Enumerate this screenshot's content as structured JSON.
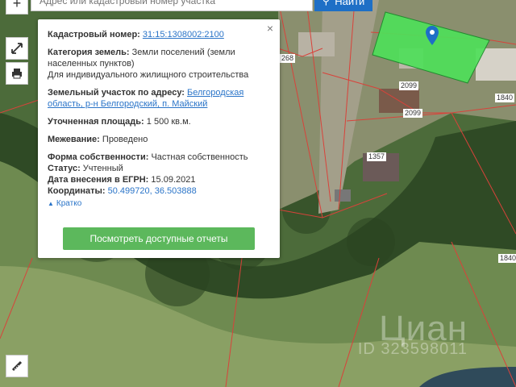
{
  "search": {
    "placeholder": "Адрес или кадастровый номер участка",
    "button_label": "Найти"
  },
  "popup": {
    "cadastral_label": "Кадастровый номер:",
    "cadastral_value": "31:15:1308002:2100",
    "category_label": "Категория земель:",
    "category_value": "Земли поселений (земли населенных пунктов)",
    "purpose": "Для индивидуального жилищного строительства",
    "address_label": "Земельный участок по адресу:",
    "address_value": "Белгородская область, р-н Белгородский, п. Майский",
    "area_label": "Уточненная площадь:",
    "area_value": "1 500 кв.м.",
    "survey_label": "Межевание:",
    "survey_value": "Проведено",
    "ownership_label": "Форма собственности:",
    "ownership_value": "Частная собственность",
    "status_label": "Статус:",
    "status_value": "Учтенный",
    "date_label": "Дата внесения в ЕГРН:",
    "date_value": "15.09.2021",
    "coords_label": "Координаты:",
    "coords_value": "50.499720, 36.503888",
    "compact_label": "Кратко",
    "reports_button": "Посмотреть доступные отчеты",
    "close": "×"
  },
  "map_labels": {
    "l268": "268",
    "l2099a": "2099",
    "l2099b": "2099",
    "l1840a": "1840",
    "l1357": "1357",
    "l1840b": "1840"
  },
  "watermark": {
    "brand": "Циан",
    "id": "ID 323598011"
  },
  "colors": {
    "parcel_fill": "#4fe05a",
    "accent": "#1e6fc6",
    "button": "#5cb85c",
    "boundary": "#d9423a"
  }
}
